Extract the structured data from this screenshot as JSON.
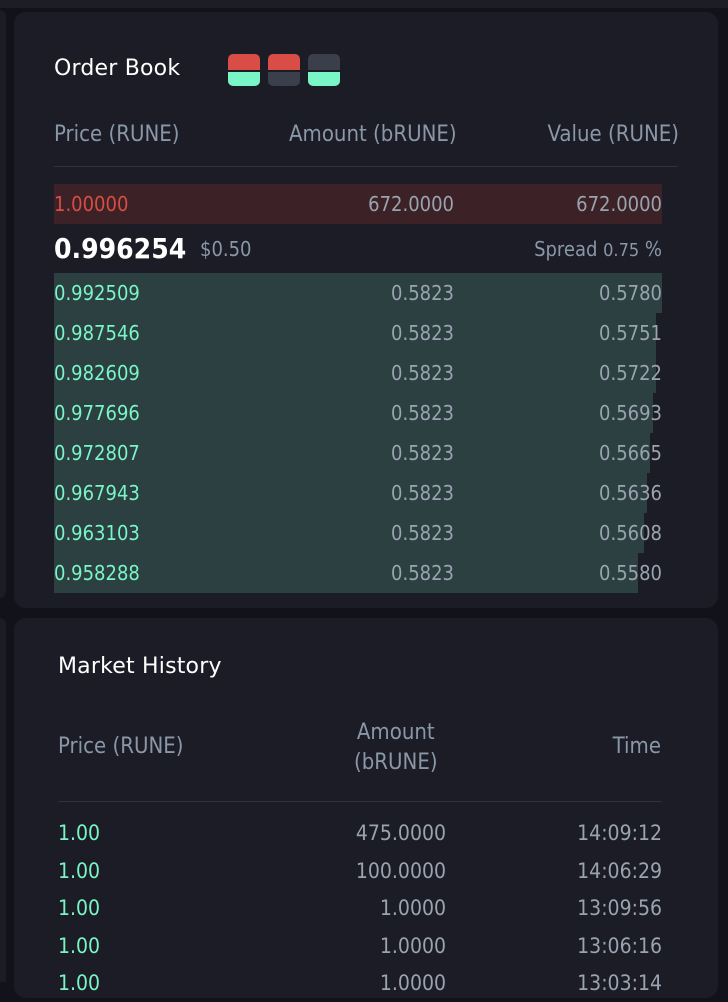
{
  "order_book": {
    "title": "Order Book",
    "colors": {
      "ask": "#d84d45",
      "bid": "#79f5c6",
      "neutral": "#3b3f4c"
    },
    "layout_toggles": [
      {
        "name": "both-sides",
        "top": "#d84d45",
        "bottom": "#79f5c6"
      },
      {
        "name": "asks-only",
        "top": "#d84d45",
        "bottom": "#3b3f4c"
      },
      {
        "name": "bids-only",
        "top": "#3b3f4c",
        "bottom": "#79f5c6"
      }
    ],
    "headers": {
      "price": "Price (RUNE)",
      "amount": "Amount (bRUNE)",
      "value": "Value (RUNE)"
    },
    "asks": [
      {
        "price": "1.00000",
        "amount": "672.0000",
        "value": "672.0000",
        "depth": 1.0
      }
    ],
    "mid": {
      "price": "0.996254",
      "usd": "$0.50",
      "spread_label": "Spread",
      "spread_value": "0.75",
      "spread_unit": "%"
    },
    "bids": [
      {
        "price": "0.992509",
        "amount": "0.5823",
        "value": "0.5780",
        "depth": 1.0
      },
      {
        "price": "0.987546",
        "amount": "0.5823",
        "value": "0.5751",
        "depth": 0.99
      },
      {
        "price": "0.982609",
        "amount": "0.5823",
        "value": "0.5722",
        "depth": 0.99
      },
      {
        "price": "0.977696",
        "amount": "0.5823",
        "value": "0.5693",
        "depth": 0.985
      },
      {
        "price": "0.972807",
        "amount": "0.5823",
        "value": "0.5665",
        "depth": 0.98
      },
      {
        "price": "0.967943",
        "amount": "0.5823",
        "value": "0.5636",
        "depth": 0.975
      },
      {
        "price": "0.963103",
        "amount": "0.5823",
        "value": "0.5608",
        "depth": 0.97
      },
      {
        "price": "0.958288",
        "amount": "0.5823",
        "value": "0.5580",
        "depth": 0.96
      }
    ]
  },
  "market_history": {
    "title": "Market History",
    "headers": {
      "price": "Price (RUNE)",
      "amount_line1": "Amount",
      "amount_line2": "(bRUNE)",
      "time": "Time"
    },
    "trades": [
      {
        "price": "1.00",
        "amount": "475.0000",
        "time": "14:09:12"
      },
      {
        "price": "1.00",
        "amount": "100.0000",
        "time": "14:06:29"
      },
      {
        "price": "1.00",
        "amount": "1.0000",
        "time": "13:09:56"
      },
      {
        "price": "1.00",
        "amount": "1.0000",
        "time": "13:06:16"
      },
      {
        "price": "1.00",
        "amount": "1.0000",
        "time": "13:03:14"
      }
    ]
  }
}
